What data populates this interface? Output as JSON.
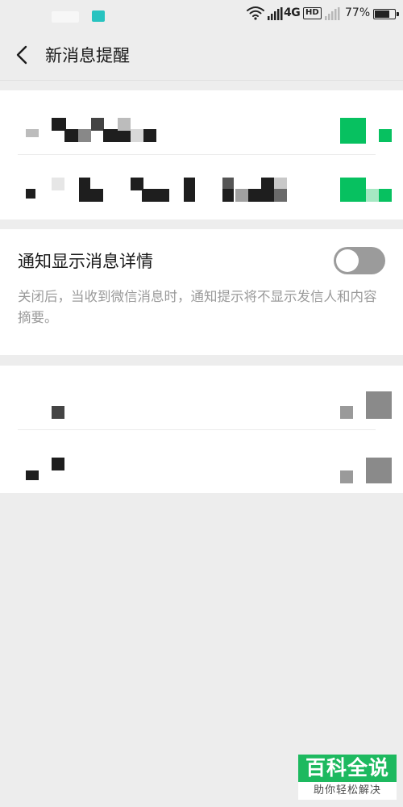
{
  "status_bar": {
    "network_type": "4G",
    "hd_badge": "HD",
    "battery_percent_text": "77%",
    "battery_level": 0.77,
    "icons": [
      "wifi-icon",
      "cell-signal-icon",
      "hd-icon",
      "cell-signal-icon",
      "battery-icon"
    ]
  },
  "header": {
    "title": "新消息提醒",
    "back_icon": "chevron-left-icon"
  },
  "notification_detail": {
    "label": "通知显示消息详情",
    "description": "关闭后，当收到微信消息时，通知提示将不显示发信人和内容摘要。",
    "enabled": false
  },
  "watermark": {
    "title": "百科全说",
    "subtitle": "助你轻松解决"
  },
  "colors": {
    "background": "#ededed",
    "card": "#ffffff",
    "text_primary": "#1b1b1b",
    "text_secondary": "#9a9a9a",
    "toggle_off_track": "#9b9b9b",
    "toggle_on_track": "#07c160",
    "accent_green": "#07c160",
    "watermark_green": "#1db95f",
    "status_teal": "#27c3c0"
  }
}
